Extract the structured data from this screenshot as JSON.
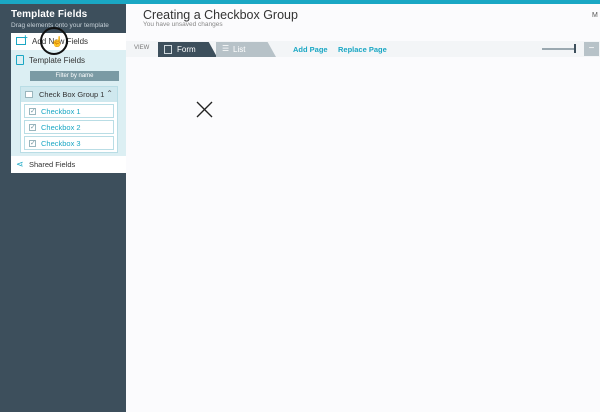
{
  "sidebar": {
    "title": "Template Fields",
    "subtitle": "Drag elements onto your template",
    "add_new_label": "Add New Fields",
    "template_fields_label": "Template Fields",
    "filter_placeholder": "Filter by name",
    "group": {
      "label": "Check Box Group 1",
      "items": [
        "Checkbox 1",
        "Checkbox 2",
        "Checkbox 3"
      ]
    },
    "shared_label": "Shared Fields"
  },
  "header": {
    "title": "Creating a Checkbox Group",
    "subtitle": "You have unsaved changes",
    "corner": "M"
  },
  "toolbar": {
    "view_label": "VIEW",
    "tabs": [
      "Form",
      "List"
    ],
    "add_page": "Add Page",
    "replace_page": "Replace Page",
    "zoom_button": "−"
  },
  "colors": {
    "accent": "#1aa7c4",
    "sidebar_bg": "#3d4f5c",
    "template_bg": "#dceff3"
  },
  "icons": [
    "add-fields-icon",
    "template-fields-icon",
    "checkbox-group-icon",
    "checkbox-icon",
    "shared-fields-icon",
    "form-icon",
    "list-icon",
    "close-icon",
    "chevron-up-icon"
  ]
}
